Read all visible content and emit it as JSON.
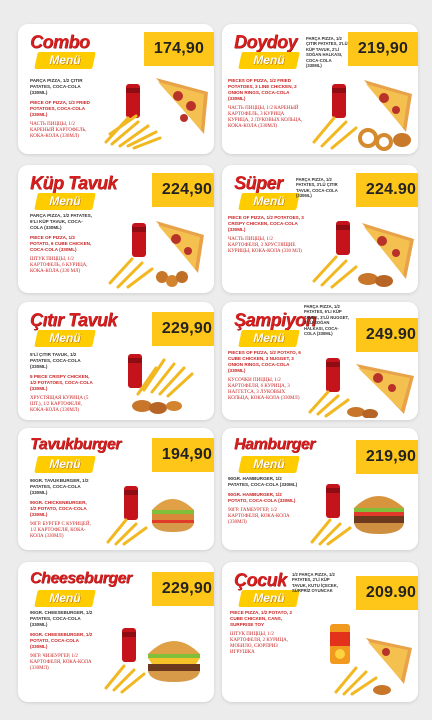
{
  "colors": {
    "title_red": "#d81e1e",
    "accent_yellow": "#ffc61a",
    "background": "#ececec"
  },
  "menus": [
    {
      "id": "combo",
      "title": "Combo",
      "tag": "Menü",
      "price": "174,90",
      "tr": "PARÇA PIZZA, 1/2 ÇITIR PATATES, COCA-COLA (330ML)",
      "en": "PIECE OF PIZZA, 1/2 FRIED POTATOES, COCA-COLA (330ML)",
      "ru": "ЧАСТЬ ПИЦЦЫ, 1/2 КАРЕНЫЙ КАРТОФЕЛЬ, КОКА-КОЛА (330мл)"
    },
    {
      "id": "doydoy",
      "title": "Doydoy",
      "tag": "Menü",
      "price": "219,90",
      "tr": "PARÇA PIZZA, 1/2 ÇITIR PATATES, 3'LÜ KÜP TAVUK, 2'Lİ SOĞAN HALKASI, COCA-COLA (330ML)",
      "en": "PIECES OF PIZZA, 1/2 FRIED POTATOES, 3 LINE CHICKEN, 2 ONION RINGS, COCA-COLA (330ML)",
      "ru": "ЧАСТЬ ПИЦЦЫ, 1/2 КАРЕНЫЙ КАРТОФЕЛЬ, 3 КУРИЦА КУРИЦА, 2 ЛУКОВЫХ КОЛЬЦА, КОКА-КОЛА (330мл)"
    },
    {
      "id": "kup-tavuk",
      "title": "Küp Tavuk",
      "tag": "Menü",
      "price": "224,90",
      "tr": "PARÇA PIZZA, 1/2 PATATES, 6'LI KÜP TAVUK, COCA-COLA (330ML)",
      "en": "PIECE OF PIZZA, 1/2 POTATO, 6 CUBE CHICKEN, COCA-COLA (330ML)",
      "ru": "ШТУК ПИЦЦЫ, 1/2 КАРТОФЕЛЬ, 6 КУРИЦА, КОКА-КОЛА (330 МЛ)"
    },
    {
      "id": "super",
      "title": "Süper",
      "tag": "Menü",
      "price": "224.90",
      "tr": "PARÇA PIZZA, 1/2 PATATES, 3'LÜ ÇITIR TAVUK, COCA-COLA (330ML)",
      "en": "PIECE OF PIZZA, 1/2 POTATOES, 3 CRISPY CHICKEN, COCA-COLA (330ML)",
      "ru": "ЧАСТЬ ПИЦЦЫ, 1/2 КАРТОФЕЛЯ, 3 ХРУСТЯЩИЕ КУРИЦЫ, КОКА-КОЛА (330 мл)"
    },
    {
      "id": "citir-tavuk",
      "title": "Çıtır Tavuk",
      "tag": "Menü",
      "price": "229,90",
      "tr": "5'Lİ ÇITIR TAVUK, 1/2 PATATES, COCA-COLA (330ML)",
      "en": "5 PIECE CRISPY CHICKEN, 1/2 POTATOES, COCA-COLA (330ML)",
      "ru": "ХРУСТЯЩАЯ КУРИЦА (5 ШТ.), 1/2 КАРТОФЕЛЯ, КОКА-КОЛА (330мл)"
    },
    {
      "id": "sampiyon",
      "title": "Şampiyon",
      "tag": "Menü",
      "price": "249.90",
      "tr": "PARÇA PIZZA, 1/2 PATATES, 6'LI KÜP TAVUK, 3'LÜ NUGGET, 3'LÜ SOĞAN HALKASI, COCA-COLA (330ML)",
      "en": "PIECES OF PIZZA, 1/2 POTATO, 6 CUBE CHICKEN, 3 NUGGET, 3 ONION RINGS, COCA-COLA (330ML)",
      "ru": "КУСОЧКИ ПИЦЦЫ, 1/2 КАРТОФЕЛЯ, 6 КУРИЦА, 3 НАГГЕТСА, 3 ЛУКОВЫХ КОЛЬЦА, КОКА-КОЛА (330мл)"
    },
    {
      "id": "tavukburger",
      "title": "Tavukburger",
      "tag": "Menü",
      "price": "194,90",
      "tr": "90GR. TAVUKBURGER, 1/2 PATATES, COCA-COLA (330ML)",
      "en": "90GR. CHICKENBURGER, 1/2 POTATO, COCA-COLA (330ML)",
      "ru": "90гр. БУРГЕР С КУРИЦЕЙ, 1/2 КАРТОФЕЛЯ, КОКА-КОЛА (330мл)"
    },
    {
      "id": "hamburger",
      "title": "Hamburger",
      "tag": "Menü",
      "price": "219,90",
      "tr": "90GR. HAMBURGER, 1/2 PATATES, COCA-COLA (330ML)",
      "en": "90GR. HAMBURGER, 1/2 POTATO, COCA-COLA (330ML)",
      "ru": "90гр. ГАМБУРГЕР, 1/2 КАРТОФЕЛЯ, КОКА-КОЛА (330мл)"
    },
    {
      "id": "cheeseburger",
      "title": "Cheeseburger",
      "tag": "Menü",
      "price": "229,90",
      "tr": "90GR. CHEESEBURGER, 1/2 PATATES, COCA-COLA (330ML)",
      "en": "90GR. CHEESEBURGER, 1/2 POTATO, COCA-COLA (330ML)",
      "ru": "90гр. ЧИЗБУРГЕР, 1/2 КАРТОФЕЛЯ, КОКА-КОЛА (330мл)"
    },
    {
      "id": "cocuk",
      "title": "Çocuk",
      "tag": "Menü",
      "price": "209.90",
      "tr": "1/2 PARÇA PIZZA, 1/2 PATATES, 2'Lİ KÜP TAVUK, KUTU İÇECEK, SÜRPRİZ OYUNCAK",
      "en": "PIECE PIZZA, 1/2 POTATO, 2 CUBE CHICKEN, CANS, SURPRISE TOY",
      "ru": "ШТУК ПИЦЦЫ, 1/2 КАРТОФЕЛЯ, 2 КУРИЦА, МОБИЛО, СЮРПРИЗ ИГРУШКА"
    }
  ]
}
